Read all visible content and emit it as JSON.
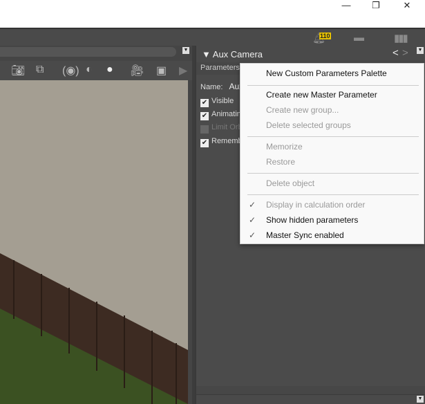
{
  "window": {
    "minimize": "—",
    "restore": "❐",
    "close": "✕"
  },
  "topbar": {
    "notification_count": "110"
  },
  "parameters_pane": {
    "title": "Aux Camera",
    "tab": "Parameters",
    "name_label": "Name:",
    "name_value": "Aux Camera",
    "checkboxes": [
      {
        "label": "Visible",
        "checked": true,
        "enabled": true
      },
      {
        "label": "Animating",
        "checked": true,
        "enabled": true
      },
      {
        "label": "Limit Orbit",
        "checked": false,
        "enabled": false
      },
      {
        "label": "Remember",
        "checked": true,
        "enabled": true
      }
    ]
  },
  "context_menu": {
    "items": [
      {
        "label": "New Custom Parameters Palette",
        "enabled": true,
        "checked": false
      },
      {
        "label": "Create new Master Parameter",
        "enabled": true,
        "checked": false
      },
      {
        "label": "Create new group...",
        "enabled": false,
        "checked": false
      },
      {
        "label": "Delete selected groups",
        "enabled": false,
        "checked": false
      },
      {
        "label": "Memorize",
        "enabled": false,
        "checked": false
      },
      {
        "label": "Restore",
        "enabled": false,
        "checked": false
      },
      {
        "label": "Delete object",
        "enabled": false,
        "checked": false
      },
      {
        "label": "Display in calculation order",
        "enabled": false,
        "checked": true
      },
      {
        "label": "Show hidden parameters",
        "enabled": true,
        "checked": true
      },
      {
        "label": "Master Sync enabled",
        "enabled": true,
        "checked": true
      }
    ]
  }
}
